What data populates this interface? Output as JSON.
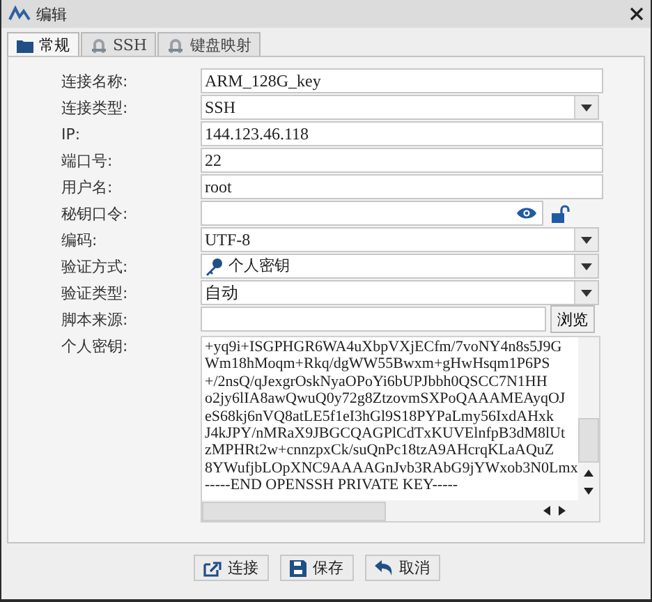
{
  "window": {
    "title": "编辑"
  },
  "tabs": [
    {
      "label": "常规",
      "selected": true
    },
    {
      "label": "SSH",
      "selected": false
    },
    {
      "label": "键盘映射",
      "selected": false
    }
  ],
  "fields": [
    {
      "label": "连接名称:",
      "kind": "text",
      "value": "ARM_128G_key"
    },
    {
      "label": "连接类型:",
      "kind": "select",
      "value": "SSH"
    },
    {
      "label": "IP:",
      "kind": "text",
      "value": "144.123.46.118"
    },
    {
      "label": "端口号:",
      "kind": "text",
      "value": "22"
    },
    {
      "label": "用户名:",
      "kind": "text",
      "value": "root"
    },
    {
      "label": "秘钥口令:",
      "kind": "password"
    },
    {
      "label": "编码:",
      "kind": "select",
      "value": "UTF-8"
    },
    {
      "label": "验证方式:",
      "kind": "select-key",
      "value": "个人密钥"
    },
    {
      "label": "验证类型:",
      "kind": "select",
      "value": "自动"
    },
    {
      "label": "脚本来源:",
      "kind": "file",
      "button": "浏览"
    },
    {
      "label": "个人密钥:",
      "kind": "textarea",
      "lines": [
        "+yq9i+ISGPHGR6WA4uXbpVXjECfm/7voNY4n8s5J9G",
        "Wm18hMoqm+Rkq/dgWW55Bwxm+gHwHsqm1P6PS",
        "+/2nsQ/qJexgrOskNyaOPoYi6bUPJbbh0QSCC7N1HH",
        "o2jy6lIA8awQwuQ0y72g8ZtzovmSXPoQAAAMEAyqOJ",
        "eS68kj6nVQ8atLE5f1eI3hGl9S18PYPaLmy56IxdAHxk",
        "J4kJPY/nMRaX9JBGCQAGPlCdTxKUVElnfpB3dM8lUt",
        "zMPHRt2w+cnnzpxCk/suQnPc18tzA9AHcrqKLaAQuZ",
        "8YWufjbLOpXNC9AAAAGnJvb3RAbG9jYWxob3N0Lmx",
        "-----END OPENSSH PRIVATE KEY-----"
      ]
    }
  ],
  "buttons": [
    {
      "label": "连接"
    },
    {
      "label": "保存"
    },
    {
      "label": "取消"
    }
  ]
}
